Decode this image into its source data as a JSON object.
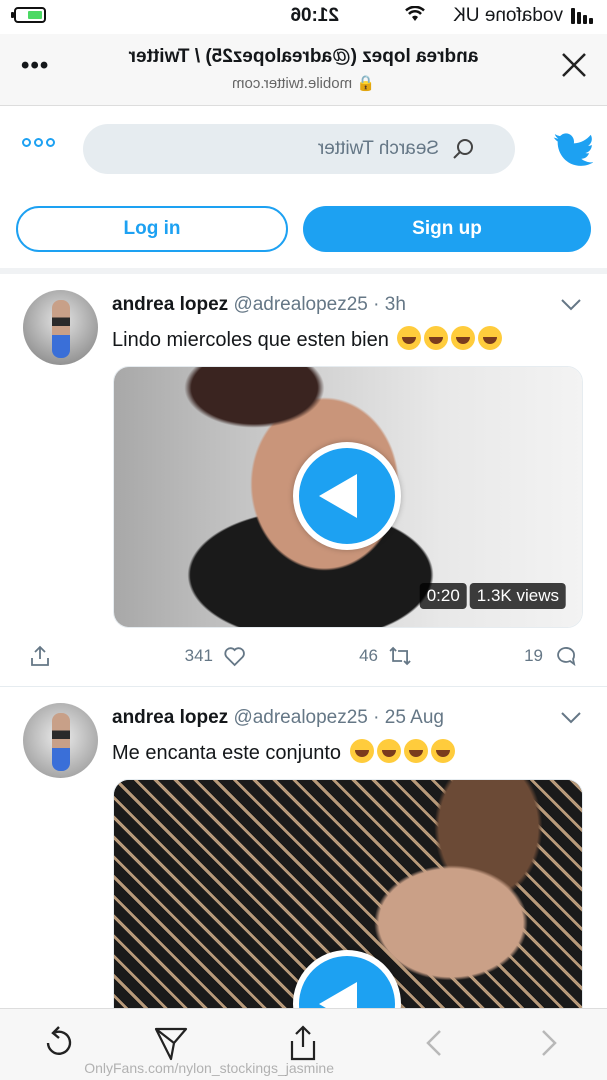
{
  "status_bar": {
    "carrier": "vodafone UK",
    "time": "21:06"
  },
  "browser": {
    "title": "andrea lopez (@adrealopez25) / Twitter",
    "url": "mobile.twitter.com"
  },
  "twitter_header": {
    "search_placeholder": "Search Twitter"
  },
  "auth": {
    "login_label": "Log in",
    "signup_label": "Sign up"
  },
  "tweets": [
    {
      "name": "andrea lopez",
      "handle": "@adrealopez25",
      "time": "3h",
      "text": "Lindo miercoles que esten bien",
      "emoji_count": 4,
      "video": {
        "duration": "0:20",
        "views": "1.3K views"
      },
      "replies": "19",
      "retweets": "46",
      "likes": "341"
    },
    {
      "name": "andrea lopez",
      "handle": "@adrealopez25",
      "time": "25 Aug",
      "text": "Me encanta este conjunto",
      "emoji_count": 4
    }
  ],
  "watermark": "OnlyFans.com/nylon_stockings_jasmine",
  "colors": {
    "twitter_blue": "#1da1f2",
    "secondary_text": "#657786"
  }
}
